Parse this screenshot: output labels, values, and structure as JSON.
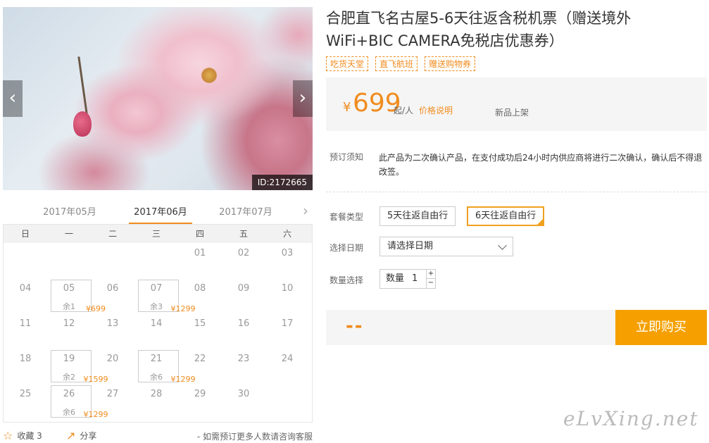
{
  "gallery": {
    "prev_glyph": "‹",
    "next_glyph": "›",
    "photo_id": "ID:2172665"
  },
  "calendar": {
    "months": [
      "2017年05月",
      "2017年06月",
      "2017年07月"
    ],
    "active_month": "2017年06月",
    "next_glyph": "›",
    "weekdays": [
      "日",
      "一",
      "二",
      "三",
      "四",
      "五",
      "六"
    ],
    "weeks": [
      [
        {
          "d": ""
        },
        {
          "d": ""
        },
        {
          "d": ""
        },
        {
          "d": ""
        },
        {
          "d": "01"
        },
        {
          "d": "02"
        },
        {
          "d": "03"
        }
      ],
      [
        {
          "d": "04"
        },
        {
          "d": "05",
          "price": "¥699",
          "left": "余1"
        },
        {
          "d": "06"
        },
        {
          "d": "07",
          "price": "¥1299",
          "left": "余3"
        },
        {
          "d": "08"
        },
        {
          "d": "09"
        },
        {
          "d": "10"
        }
      ],
      [
        {
          "d": "11"
        },
        {
          "d": "12"
        },
        {
          "d": "13"
        },
        {
          "d": "14"
        },
        {
          "d": "15"
        },
        {
          "d": "16"
        },
        {
          "d": "17"
        }
      ],
      [
        {
          "d": "18"
        },
        {
          "d": "19",
          "price": "¥1599",
          "left": "余2"
        },
        {
          "d": "20"
        },
        {
          "d": "21",
          "price": "¥1299",
          "left": "余6"
        },
        {
          "d": "22"
        },
        {
          "d": "23"
        },
        {
          "d": "24"
        }
      ],
      [
        {
          "d": "25"
        },
        {
          "d": "26",
          "price": "¥1299",
          "left": "余6"
        },
        {
          "d": "27"
        },
        {
          "d": "28"
        },
        {
          "d": "29"
        },
        {
          "d": "30"
        },
        {
          "d": ""
        }
      ]
    ]
  },
  "actions": {
    "fav_label": "收藏 3",
    "share_label": "分享",
    "consult": "- 如需预订更多人数请咨询客服"
  },
  "product": {
    "title": "合肥直飞名古屋5-6天往返含税机票（赠送境外WiFi+BIC CAMERA免税店优惠券）",
    "tags": [
      "吃货天堂",
      "直飞航班",
      "赠送购物券"
    ],
    "currency": "¥",
    "price": "699",
    "per": "起/人",
    "price_note": "价格说明",
    "new_item": "新品上架",
    "notice_label": "预订须知",
    "notice_text": "此产品为二次确认产品，在支付成功后24小时内供应商将进行二次确认，确认后不得退改签。",
    "package_label": "套餐类型",
    "packages": [
      "5天往返自由行",
      "6天往返自由行"
    ],
    "selected_package": "6天往返自由行",
    "date_label": "选择日期",
    "date_placeholder": "请选择日期",
    "qty_label": "数量选择",
    "qty_text": "数量",
    "qty_value": "1",
    "total": "--",
    "buy_label": "立即购买"
  },
  "watermark": "eLvXing.net",
  "colors": {
    "accent": "#f08c1e",
    "buy": "#f5a000"
  }
}
